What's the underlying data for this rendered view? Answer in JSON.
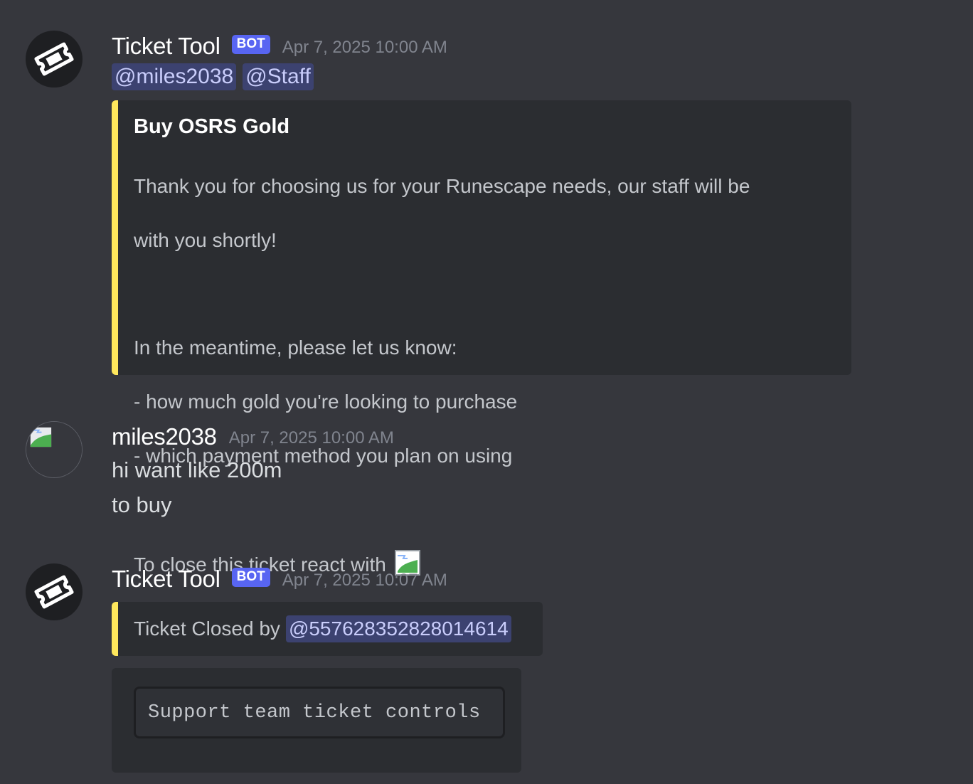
{
  "messages": [
    {
      "author": "Ticket Tool",
      "tag": "BOT",
      "timestamp": "Apr 7, 2025 10:00 AM",
      "mentions": [
        "@miles2038",
        "@Staff"
      ],
      "embed": {
        "title": "Buy OSRS Gold",
        "line1": "Thank you for choosing us for your Runescape needs, our staff will be",
        "line2": "with you shortly!",
        "line3": "In the meantime, please let us know:",
        "line4": "- how much gold you're looking to purchase",
        "line5": "- which payment method you plan on using",
        "line6": "To close this ticket react with",
        "accent": "#fee75c"
      },
      "avatar_icon": "ticket-icon"
    },
    {
      "author": "miles2038",
      "timestamp": "Apr 7, 2025 10:00 AM",
      "lines": [
        "hi want like 200m",
        "to buy"
      ],
      "avatar_icon": "broken-image-icon"
    },
    {
      "author": "Ticket Tool",
      "tag": "BOT",
      "timestamp": "Apr 7, 2025 10:07 AM",
      "embed": {
        "text": "Ticket Closed by",
        "mention": "@557628352828014614",
        "accent": "#fee75c"
      },
      "control_label": "Support team ticket controls",
      "avatar_icon": "ticket-icon"
    }
  ],
  "colors": {
    "background": "#36373d",
    "embed_background": "#2b2d31",
    "bot_tag": "#5865f2",
    "mention_text": "#c9cdfb",
    "timestamp": "#80848e"
  }
}
